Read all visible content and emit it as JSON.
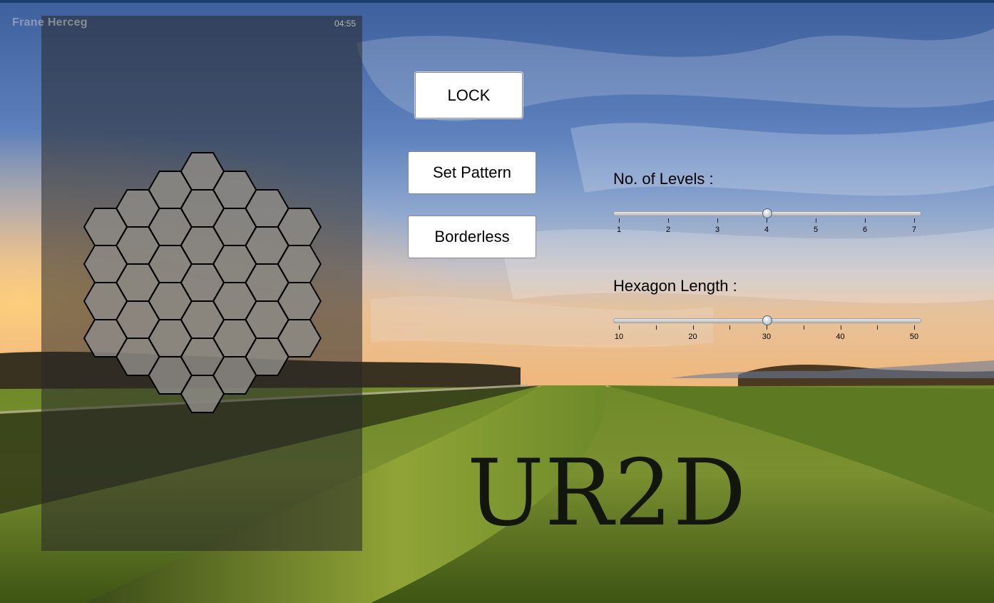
{
  "window": {
    "author": "Frane Herceg",
    "clock": "04:55"
  },
  "buttons": {
    "lock": "LOCK",
    "set_pattern": "Set Pattern",
    "borderless": "Borderless"
  },
  "sliders": {
    "levels": {
      "label": "No. of Levels :",
      "min": 1,
      "max": 7,
      "value": 4,
      "tick_labels": [
        "1",
        "2",
        "3",
        "4",
        "5",
        "6",
        "7"
      ]
    },
    "hex_length": {
      "label": "Hexagon Length :",
      "min": 10,
      "max": 50,
      "value": 30,
      "tick_labels": [
        "10",
        "20",
        "30",
        "40",
        "50"
      ]
    }
  },
  "logo": "UR2D",
  "hex_grid": {
    "levels": 4,
    "fill": "#8c8985",
    "stroke": "#000000"
  },
  "colors": {
    "topbar": "#1d3f6e",
    "overlay": "rgba(40,40,40,0.55)"
  }
}
